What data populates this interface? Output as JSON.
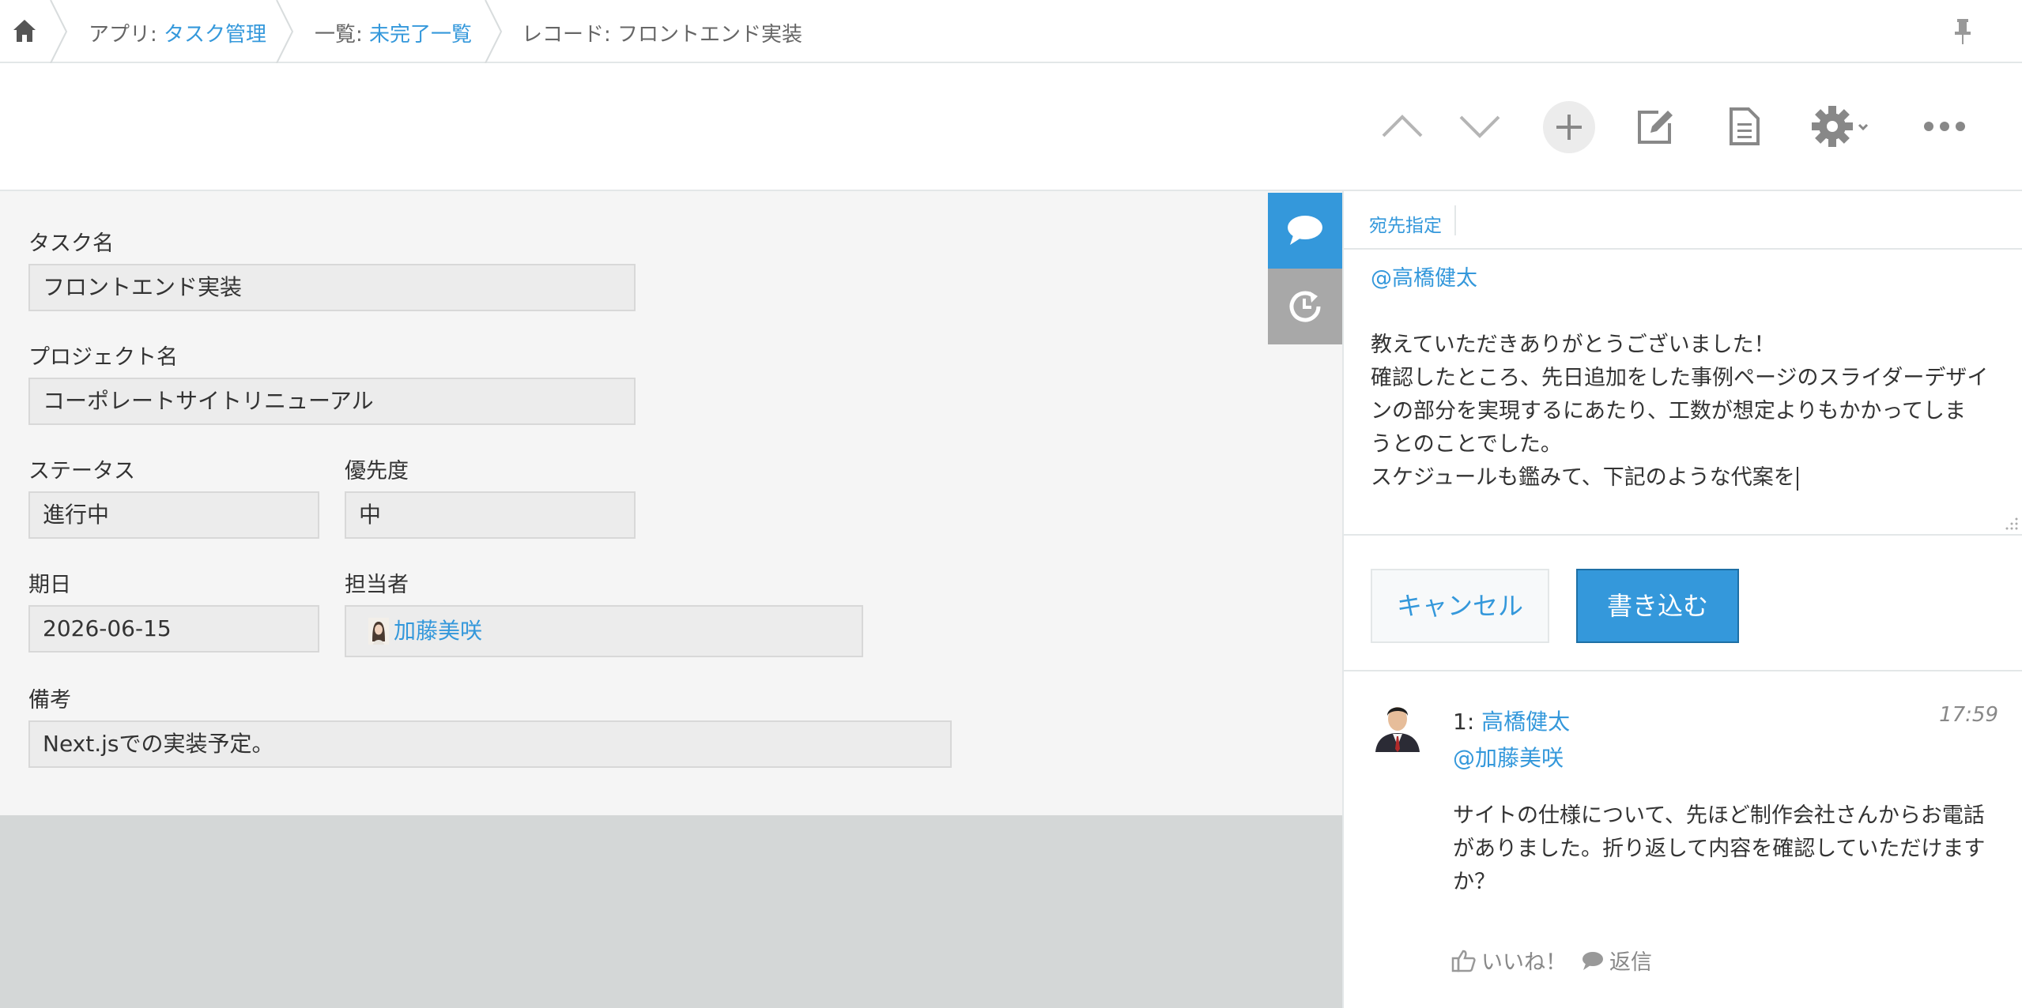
{
  "breadcrumb": {
    "app_prefix": "アプリ: ",
    "app_name": "タスク管理",
    "view_prefix": "一覧: ",
    "view_name": "未完了一覧",
    "record_label": "レコード: フロントエンド実装"
  },
  "icons": {
    "home": "home-icon",
    "pin": "pin-icon",
    "prev": "chevron-up-icon",
    "next": "chevron-down-icon",
    "add": "plus-icon",
    "edit": "edit-icon",
    "duplicate": "document-icon",
    "settings": "gear-icon",
    "more": "more-icon",
    "comments_tab": "speech-bubble-icon",
    "history_tab": "history-icon",
    "like": "thumbs-up-icon",
    "reply": "speech-bubble-icon"
  },
  "colors": {
    "accent": "#3498db",
    "record_bg": "#f5f5f5",
    "field_bg": "#ececec",
    "history_tab": "#a8a8a8"
  },
  "record": {
    "fields": {
      "task_name": {
        "label": "タスク名",
        "value": "フロントエンド実装"
      },
      "project_name": {
        "label": "プロジェクト名",
        "value": "コーポレートサイトリニューアル"
      },
      "status": {
        "label": "ステータス",
        "value": "進行中"
      },
      "priority": {
        "label": "優先度",
        "value": "中"
      },
      "due_date": {
        "label": "期日",
        "value": "2026-06-15"
      },
      "assignee": {
        "label": "担当者",
        "value": "加藤美咲"
      },
      "notes": {
        "label": "備考",
        "value": "Next.jsでの実装予定。"
      }
    }
  },
  "comment_editor": {
    "mention_tab_label": "宛先指定",
    "lines": [
      "@高橋健太",
      "",
      "教えていただきありがとうございました！",
      "確認したところ、先日追加をした事例ページのスライダーデザイ",
      "ンの部分を実現するにあたり、工数が想定よりもかかってしま",
      "うとのことでした。",
      "スケジュールも鑑みて、下記のような代案を"
    ],
    "cancel_label": "キャンセル",
    "submit_label": "書き込む"
  },
  "comments": [
    {
      "number": "1:",
      "author": "高橋健太",
      "time": "17:59",
      "mention": "@加藤美咲",
      "body": "サイトの仕様について、先ほど制作会社さんからお電話がありました。折り返して内容を確認していただけますか？",
      "like_label": "いいね！",
      "reply_label": "返信"
    }
  ]
}
